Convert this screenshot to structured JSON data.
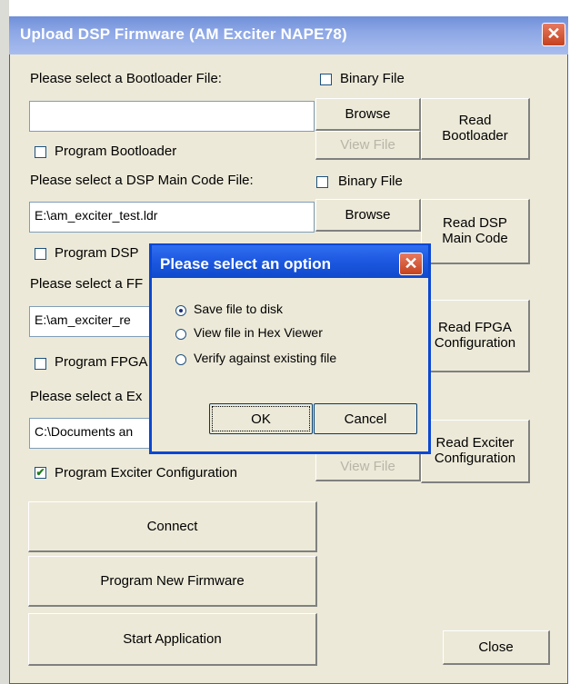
{
  "window": {
    "title": "Upload DSP Firmware (AM Exciter NAPE78)",
    "close_glyph": "✕"
  },
  "bootloader": {
    "prompt": "Please select a Bootloader File:",
    "binary_label": "Binary File",
    "binary_checked": false,
    "path": "",
    "browse": "Browse",
    "view": "View File",
    "read": "Read\nBootloader",
    "program_label": "Program Bootloader",
    "program_checked": false
  },
  "dsp": {
    "prompt": "Please select a DSP Main Code File:",
    "binary_label": "Binary File",
    "binary_checked": false,
    "path": "E:\\am_exciter_test.ldr",
    "browse": "Browse",
    "read": "Read DSP\nMain Code",
    "program_label": "Program DSP",
    "program_checked": false
  },
  "fpga": {
    "prompt": "Please select a FF",
    "path": "E:\\am_exciter_re",
    "read": "Read FPGA\nConfiguration",
    "program_label": "Program FPGA",
    "program_checked": false
  },
  "exciter": {
    "prompt": "Please select a Ex",
    "path": "C:\\Documents an",
    "view": "View File",
    "read": "Read Exciter\nConfiguration",
    "program_label": "Program Exciter Configuration",
    "program_checked": true
  },
  "actions": {
    "connect": "Connect",
    "program": "Program New Firmware",
    "start": "Start Application",
    "close": "Close"
  },
  "dialog": {
    "title": "Please select an option",
    "close_glyph": "✕",
    "options": [
      {
        "label": "Save file to disk",
        "selected": true
      },
      {
        "label": "View file in Hex Viewer",
        "selected": false
      },
      {
        "label": "Verify against existing file",
        "selected": false
      }
    ],
    "ok": "OK",
    "cancel": "Cancel"
  },
  "colors": {
    "window_face": "#ece9d8",
    "title_active": "#0f49cc",
    "title_inactive": "#8da7e6",
    "close_red": "#c4421f"
  }
}
